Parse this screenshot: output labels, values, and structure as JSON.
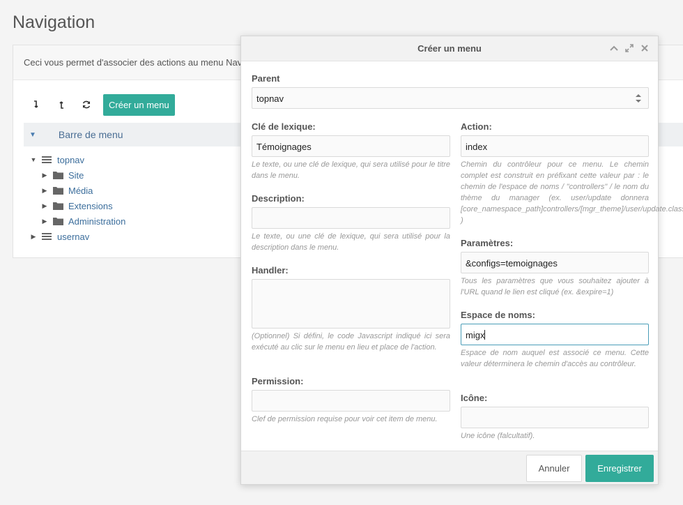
{
  "page": {
    "title": "Navigation",
    "intro": "Ceci vous permet d'associer des actions au menu Navigation"
  },
  "toolbar": {
    "create_label": "Créer un menu"
  },
  "tree": {
    "header": "Barre de menu",
    "nodes": [
      {
        "label": "topnav"
      },
      {
        "label": "Site"
      },
      {
        "label": "Média"
      },
      {
        "label": "Extensions"
      },
      {
        "label": "Administration"
      },
      {
        "label": "usernav"
      }
    ]
  },
  "modal": {
    "title": "Créer un menu",
    "parent": {
      "label": "Parent",
      "value": "topnav"
    },
    "lexicon": {
      "label": "Clé de lexique:",
      "value": "Témoignages",
      "hint": "Le texte, ou une clé de lexique, qui sera utilisé pour le titre dans le menu."
    },
    "description": {
      "label": "Description:",
      "value": "",
      "hint": "Le texte, ou une clé de lexique, qui sera utilisé pour la description dans le menu."
    },
    "handler": {
      "label": "Handler:",
      "value": "",
      "hint": "(Optionnel) Si défini, le code Javascript indiqué ici sera exécuté au clic sur le menu en lieu et place de l'action."
    },
    "permission": {
      "label": "Permission:",
      "value": "",
      "hint": "Clef de permission requise pour voir cet item de menu."
    },
    "action": {
      "label": "Action:",
      "value": "index",
      "hint": "Chemin du contrôleur pour ce menu. Le chemin complet est construit en préfixant cette valeur par : le chemin de l'espace de noms / \"controllers\" / le nom du thème du manager (ex. user/update donnera [core_namespace_path]controllers/[mgr_theme]/user/update.class.php )"
    },
    "params": {
      "label": "Paramètres:",
      "value": "&configs=temoignages",
      "hint": "Tous les paramètres que vous souhaitez ajouter à l'URL quand le lien est cliqué (ex. &expire=1)"
    },
    "namespace": {
      "label": "Espace de noms:",
      "value": "migx",
      "hint": "Espace de nom auquel est associé ce menu. Cette valeur déterminera le chemin d'accès au contrôleur."
    },
    "icon": {
      "label": "Icône:",
      "value": "",
      "hint": "Une icône (falcultatif)."
    },
    "cancel_label": "Annuler",
    "save_label": "Enregistrer"
  },
  "colors": {
    "accent": "#32ab9a",
    "link": "#3c6e9c"
  }
}
